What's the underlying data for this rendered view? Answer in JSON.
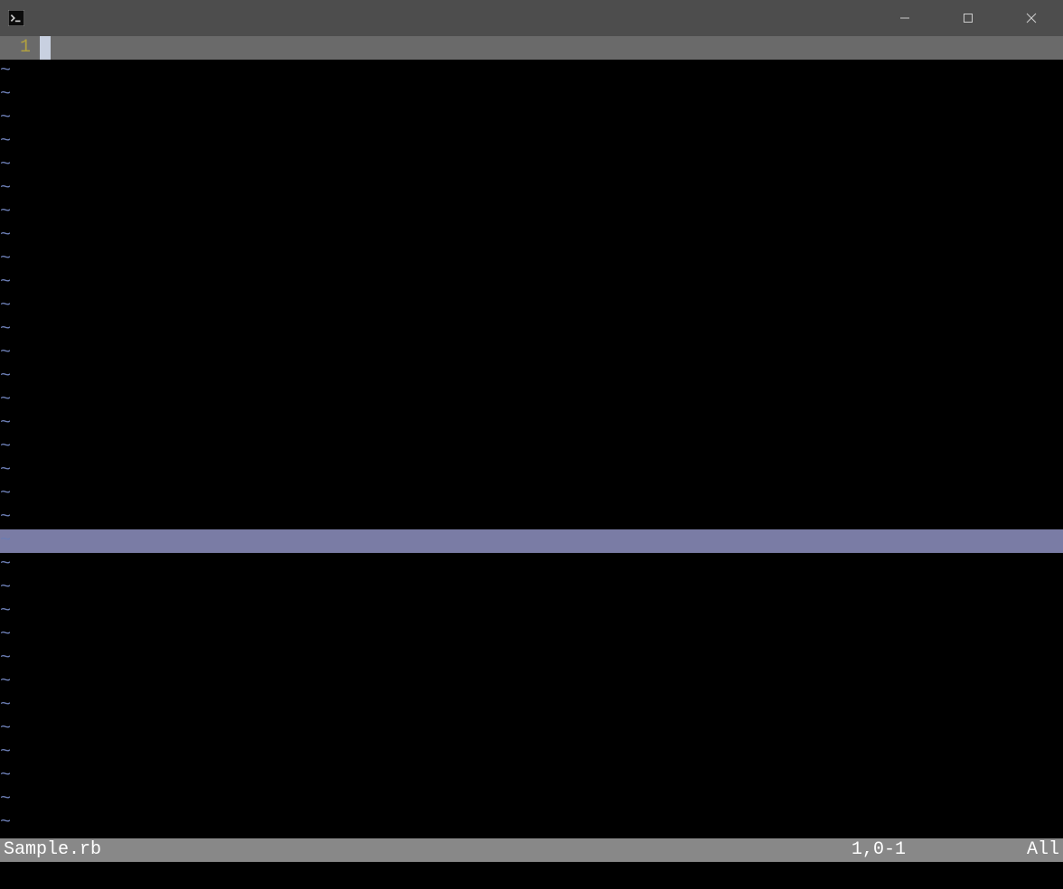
{
  "titlebar": {
    "app_icon": "terminal-icon"
  },
  "window_controls": {
    "minimize": "minimize",
    "maximize": "maximize",
    "close": "close"
  },
  "editor": {
    "current_line_number": "1",
    "line_content": "",
    "tilde_char": "~",
    "empty_line_count_before_highlight": 20,
    "highlighted_tilde_index": 21,
    "empty_line_count_after_highlight": 12
  },
  "status_bar": {
    "filename": "Sample.rb",
    "position": "1,0-1",
    "scroll": "All"
  }
}
